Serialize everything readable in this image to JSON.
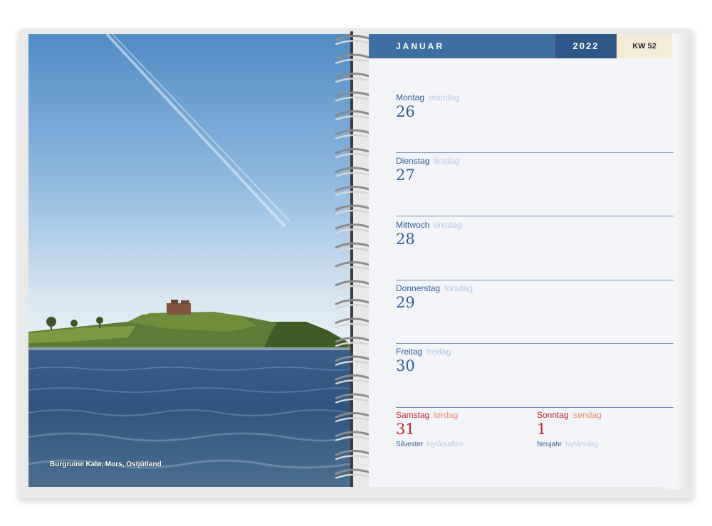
{
  "photo": {
    "caption": "Burgruine Kalø, Mors, Ostjütland"
  },
  "header": {
    "month": "JANUAR",
    "year": "2022",
    "week": "KW 52"
  },
  "days": [
    {
      "name": "Montag",
      "name_dk": "mandag",
      "date": "26"
    },
    {
      "name": "Dienstag",
      "name_dk": "tirsdag",
      "date": "27"
    },
    {
      "name": "Mittwoch",
      "name_dk": "onsdag",
      "date": "28"
    },
    {
      "name": "Donnerstag",
      "name_dk": "torsdag",
      "date": "29"
    },
    {
      "name": "Freitag",
      "name_dk": "fredag",
      "date": "30"
    }
  ],
  "weekend": [
    {
      "name": "Samstag",
      "name_dk": "lørdag",
      "date": "31",
      "holiday": "Silvester",
      "holiday_dk": "Nytårsaften"
    },
    {
      "name": "Sonntag",
      "name_dk": "søndag",
      "date": "1",
      "holiday": "Neujahr",
      "holiday_dk": "Nytårsdag"
    }
  ],
  "colors": {
    "header_month": "#3d6fa3",
    "header_year": "#2e5688",
    "header_week": "#f4ecd6",
    "weekday_text": "#2f5f98",
    "weekend_text": "#c0272d",
    "danish_text": "#b6c9e2"
  }
}
